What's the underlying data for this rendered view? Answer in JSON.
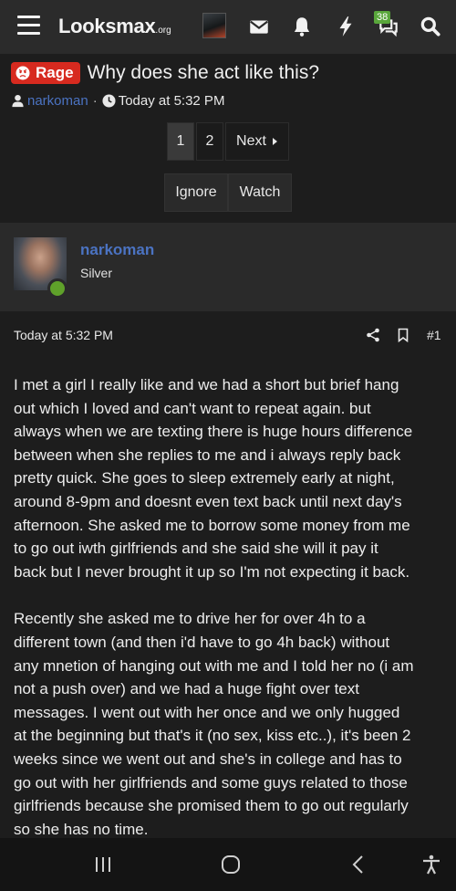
{
  "header": {
    "logo_text": "Looksmax",
    "logo_suffix": ".org",
    "alerts_count": "38",
    "icons": [
      "menu-icon",
      "inbox-icon",
      "bell-icon",
      "bolt-icon",
      "chat-icon",
      "search-icon"
    ]
  },
  "thread": {
    "prefix": "Rage",
    "title": "Why does she act like this?",
    "author": "narkoman",
    "meta_separator": "·",
    "time": "Today at 5:32 PM"
  },
  "pagination": {
    "pages": [
      "1",
      "2"
    ],
    "current_page": "1",
    "next_label": "Next"
  },
  "thread_actions": {
    "ignore_label": "Ignore",
    "watch_label": "Watch"
  },
  "post": {
    "username": "narkoman",
    "rank": "Silver",
    "date": "Today at 5:32 PM",
    "number": "#1",
    "paragraphs": [
      "I met a girl I really like and we had a short but brief hang\nout which I loved and can't want to repeat again. but\nalways when we are texting there is huge hours difference\nbetween when she replies to me and i always reply back\npretty quick. She goes to sleep extremely early at night,\naround 8-9pm and doesnt even text back until next day's\nafternoon. She asked me to borrow some money from me\nto go out iwth girlfriends and she said she will it pay it\nback but I never brought it up so I'm not expecting it back.",
      "Recently she asked me to drive her for over 4h to a\ndifferent town (and then i'd have to go 4h back) without\nany mnetion of hanging out with me and I told her no (i am\nnot a push over) and we had a huge fight over text\nmessages. I went out with her once and we only hugged\nat the beginning but that's it (no sex, kiss etc..), it's been 2\nweeks since we went out and she's in college and has to\ngo out with her girlfriends and some guys related to those\ngirlfriends because she promised them to go out regularly\nso she has no time."
    ]
  },
  "colors": {
    "page_bg": "#1d1d1d",
    "topbar_bg": "#2b2b2b",
    "user_link": "#4b73c2",
    "rage_prefix": "#d72a1f",
    "online": "#5fa12a",
    "alert_badge": "#59a63b"
  },
  "system_nav": {
    "icons": [
      "recent-apps-icon",
      "home-icon",
      "back-icon",
      "accessibility-icon"
    ]
  }
}
